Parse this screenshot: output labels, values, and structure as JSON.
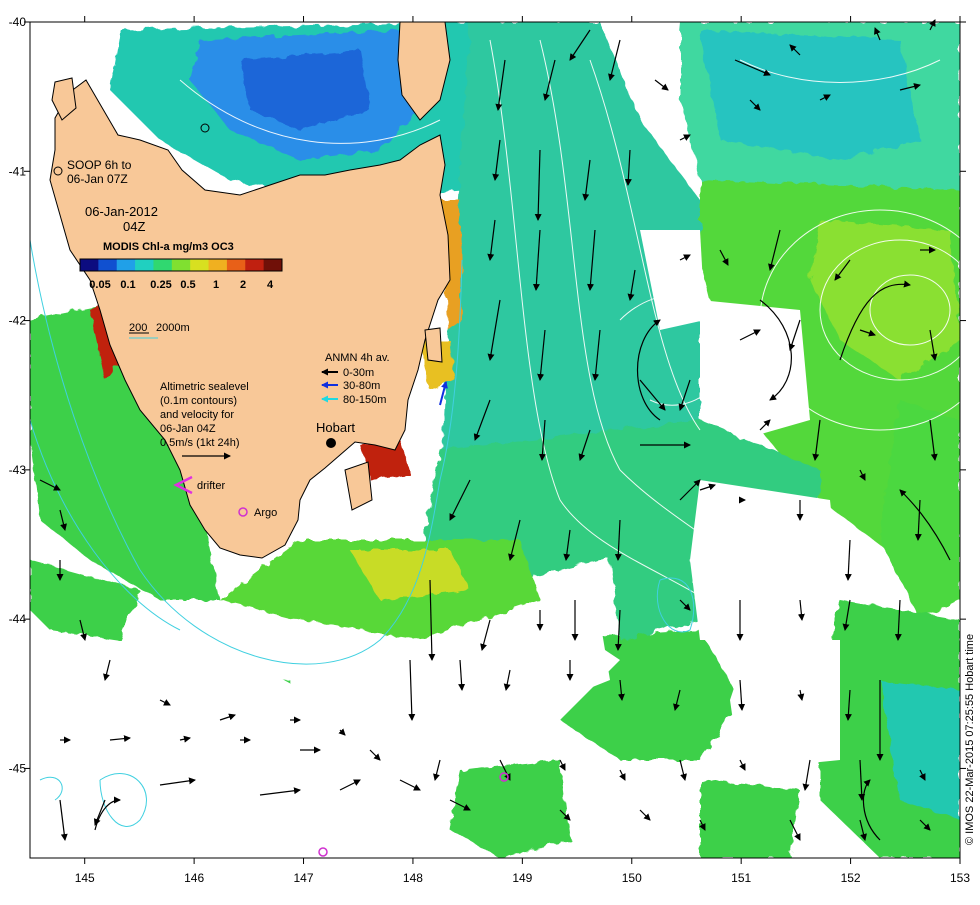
{
  "map": {
    "x_ticks": [
      "145",
      "146",
      "147",
      "148",
      "149",
      "150",
      "151",
      "152",
      "153"
    ],
    "y_ticks": [
      "-40",
      "-41",
      "-42",
      "-43",
      "-44",
      "-45"
    ],
    "lon_range": [
      144.5,
      153
    ],
    "lat_range": [
      -45.6,
      -40
    ],
    "land_color": "#f8c898",
    "ocean_colors": {
      "low": "#2070e0",
      "mid": "#20c8b0",
      "green": "#40d840",
      "high": "#e8d020",
      "peak": "#c82010"
    }
  },
  "soop": {
    "line1": "SOOP 6h to",
    "line2": "06-Jan 07Z"
  },
  "timestamp": {
    "date": "06-Jan-2012",
    "time": "04Z"
  },
  "colorbar": {
    "title": "MODIS Chl-a mg/m3 OC3",
    "labels": [
      "0.05",
      "0.1",
      "0.25",
      "0.5",
      "1",
      "2",
      "4"
    ],
    "colors": [
      "#0c0c80",
      "#1050d0",
      "#20a0e8",
      "#20d0c0",
      "#30d870",
      "#80e030",
      "#d8e020",
      "#f0b020",
      "#e86018",
      "#c02010",
      "#701008"
    ]
  },
  "isobath": {
    "label_200": "200",
    "label_2000": "2000m",
    "color": "#40d0e0"
  },
  "anmn": {
    "title": "ANMN 4h av.",
    "rows": [
      {
        "label": "0-30m",
        "color": "#000000"
      },
      {
        "label": "30-80m",
        "color": "#1030e0"
      },
      {
        "label": "80-150m",
        "color": "#20d8e0"
      }
    ]
  },
  "altimetry": {
    "lines": [
      "Altimetric sealevel",
      "(0.1m contours)",
      "and velocity for",
      "06-Jan 04Z",
      "0.5m/s (1kt 24h)"
    ]
  },
  "places": {
    "hobart": "Hobart"
  },
  "legend_markers": {
    "drifter": "drifter",
    "argo": "Argo",
    "drifter_color": "#e030e0",
    "argo_color": "#d030d0"
  },
  "credit": "© IMOS 22-Mar-2015 07:25:55 Hobart time"
}
